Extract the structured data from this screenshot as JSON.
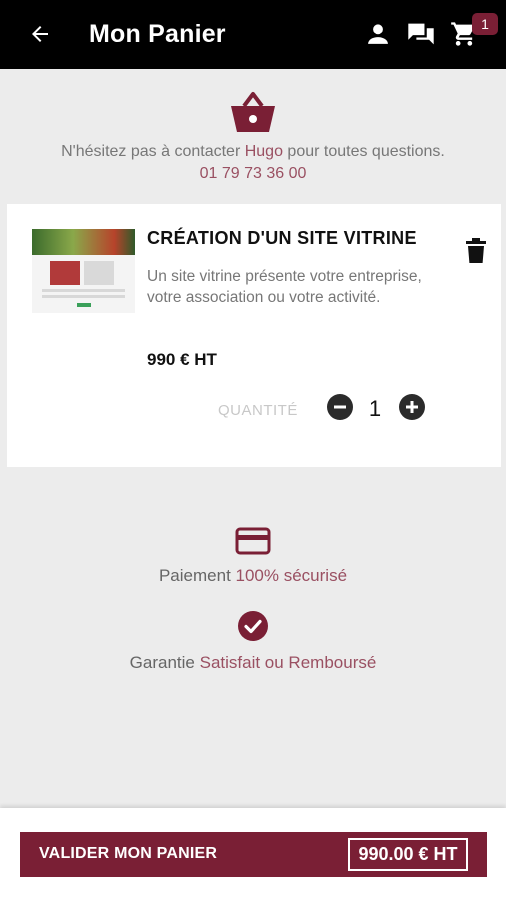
{
  "header": {
    "title": "Mon Panier",
    "cart_count": "1",
    "icons": [
      "back-arrow-icon",
      "user-icon",
      "chat-icon",
      "cart-icon"
    ]
  },
  "contact": {
    "text_before": "N'hésitez pas à contacter ",
    "name": "Hugo",
    "text_after": " pour toutes questions.",
    "phone": "01 79 73 36 00"
  },
  "item": {
    "title": "CRÉATION D'UN SITE VITRINE",
    "description": "Un site vitrine présente votre entreprise, votre association ou votre activité.",
    "price": "990 € HT",
    "quantity_label": "QUANTITÉ",
    "quantity": "1"
  },
  "features": {
    "payment_prefix": "Paiement ",
    "payment_accent": "100% sécurisé",
    "guarantee_prefix": "Garantie ",
    "guarantee_accent": "Satisfait ou Remboursé"
  },
  "footer": {
    "validate_label": "VALIDER MON PANIER",
    "total": "990.00 € HT"
  },
  "colors": {
    "accent": "#7a1f35",
    "header_bg": "#000000",
    "background": "#ececec"
  }
}
